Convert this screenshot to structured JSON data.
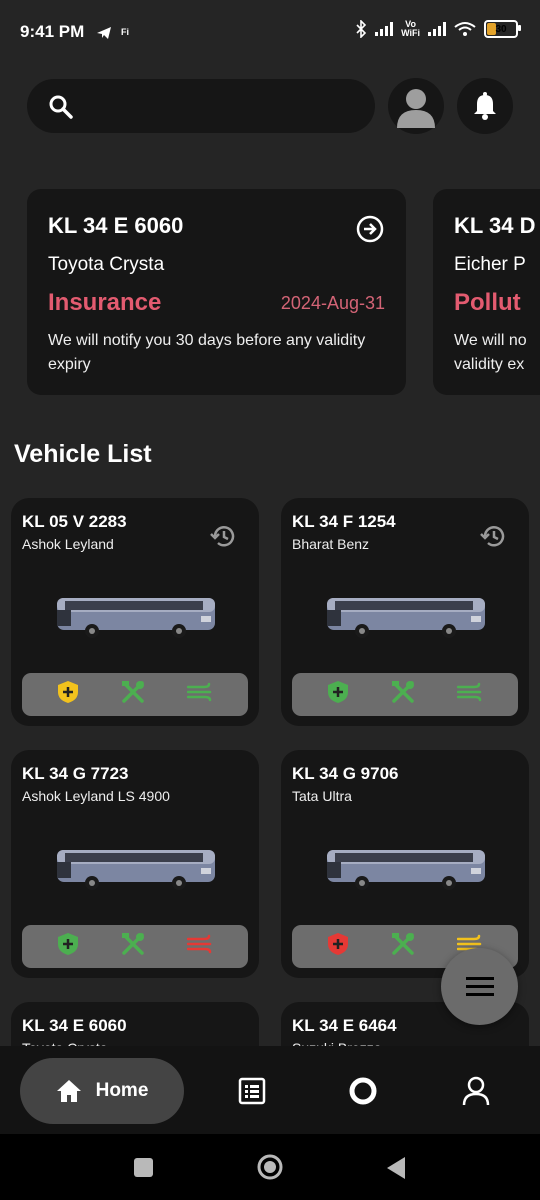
{
  "status_bar": {
    "time": "9:41 PM",
    "vo": "Vo",
    "wifi_label": "WiFi",
    "battery": "30",
    "carrier_badge": "Fi"
  },
  "header": {
    "search_placeholder": ""
  },
  "reminders": [
    {
      "plate": "KL 34 E 6060",
      "model": "Toyota Crysta",
      "type": "Insurance",
      "date": "2024-Aug-31",
      "message": "We will notify you 30 days before any validity expiry"
    },
    {
      "plate": "KL 34 D",
      "model": "Eicher P",
      "type": "Pollut",
      "date": "",
      "message": "We will no validity ex"
    }
  ],
  "vehicle_list": {
    "title": "Vehicle List",
    "vehicles": [
      {
        "plate": "KL 05 V 2283",
        "model": "Ashok Leyland",
        "status_colors": [
          "#f2c21d",
          "#4caf50",
          "#4caf50"
        ]
      },
      {
        "plate": "KL 34 F 1254",
        "model": "Bharat Benz",
        "status_colors": [
          "#4caf50",
          "#4caf50",
          "#4caf50"
        ]
      },
      {
        "plate": "KL 34 G 7723",
        "model": "Ashok Leyland LS 4900",
        "status_colors": [
          "#4caf50",
          "#4caf50",
          "#e53935"
        ]
      },
      {
        "plate": "KL 34 G 9706",
        "model": "Tata Ultra",
        "status_colors": [
          "#e53935",
          "#4caf50",
          "#f2c21d"
        ]
      },
      {
        "plate": "KL 34 E 6060",
        "model": "Toyota Crysta"
      },
      {
        "plate": "KL 34 E 6464",
        "model": "Suzuki Brezza"
      }
    ]
  },
  "bottom_nav": {
    "home_label": "Home"
  },
  "colors": {
    "background": "#252525",
    "card": "#161616",
    "accent_red": "#e35b70",
    "ok": "#4caf50",
    "warn": "#f2c21d",
    "alert": "#e53935"
  }
}
